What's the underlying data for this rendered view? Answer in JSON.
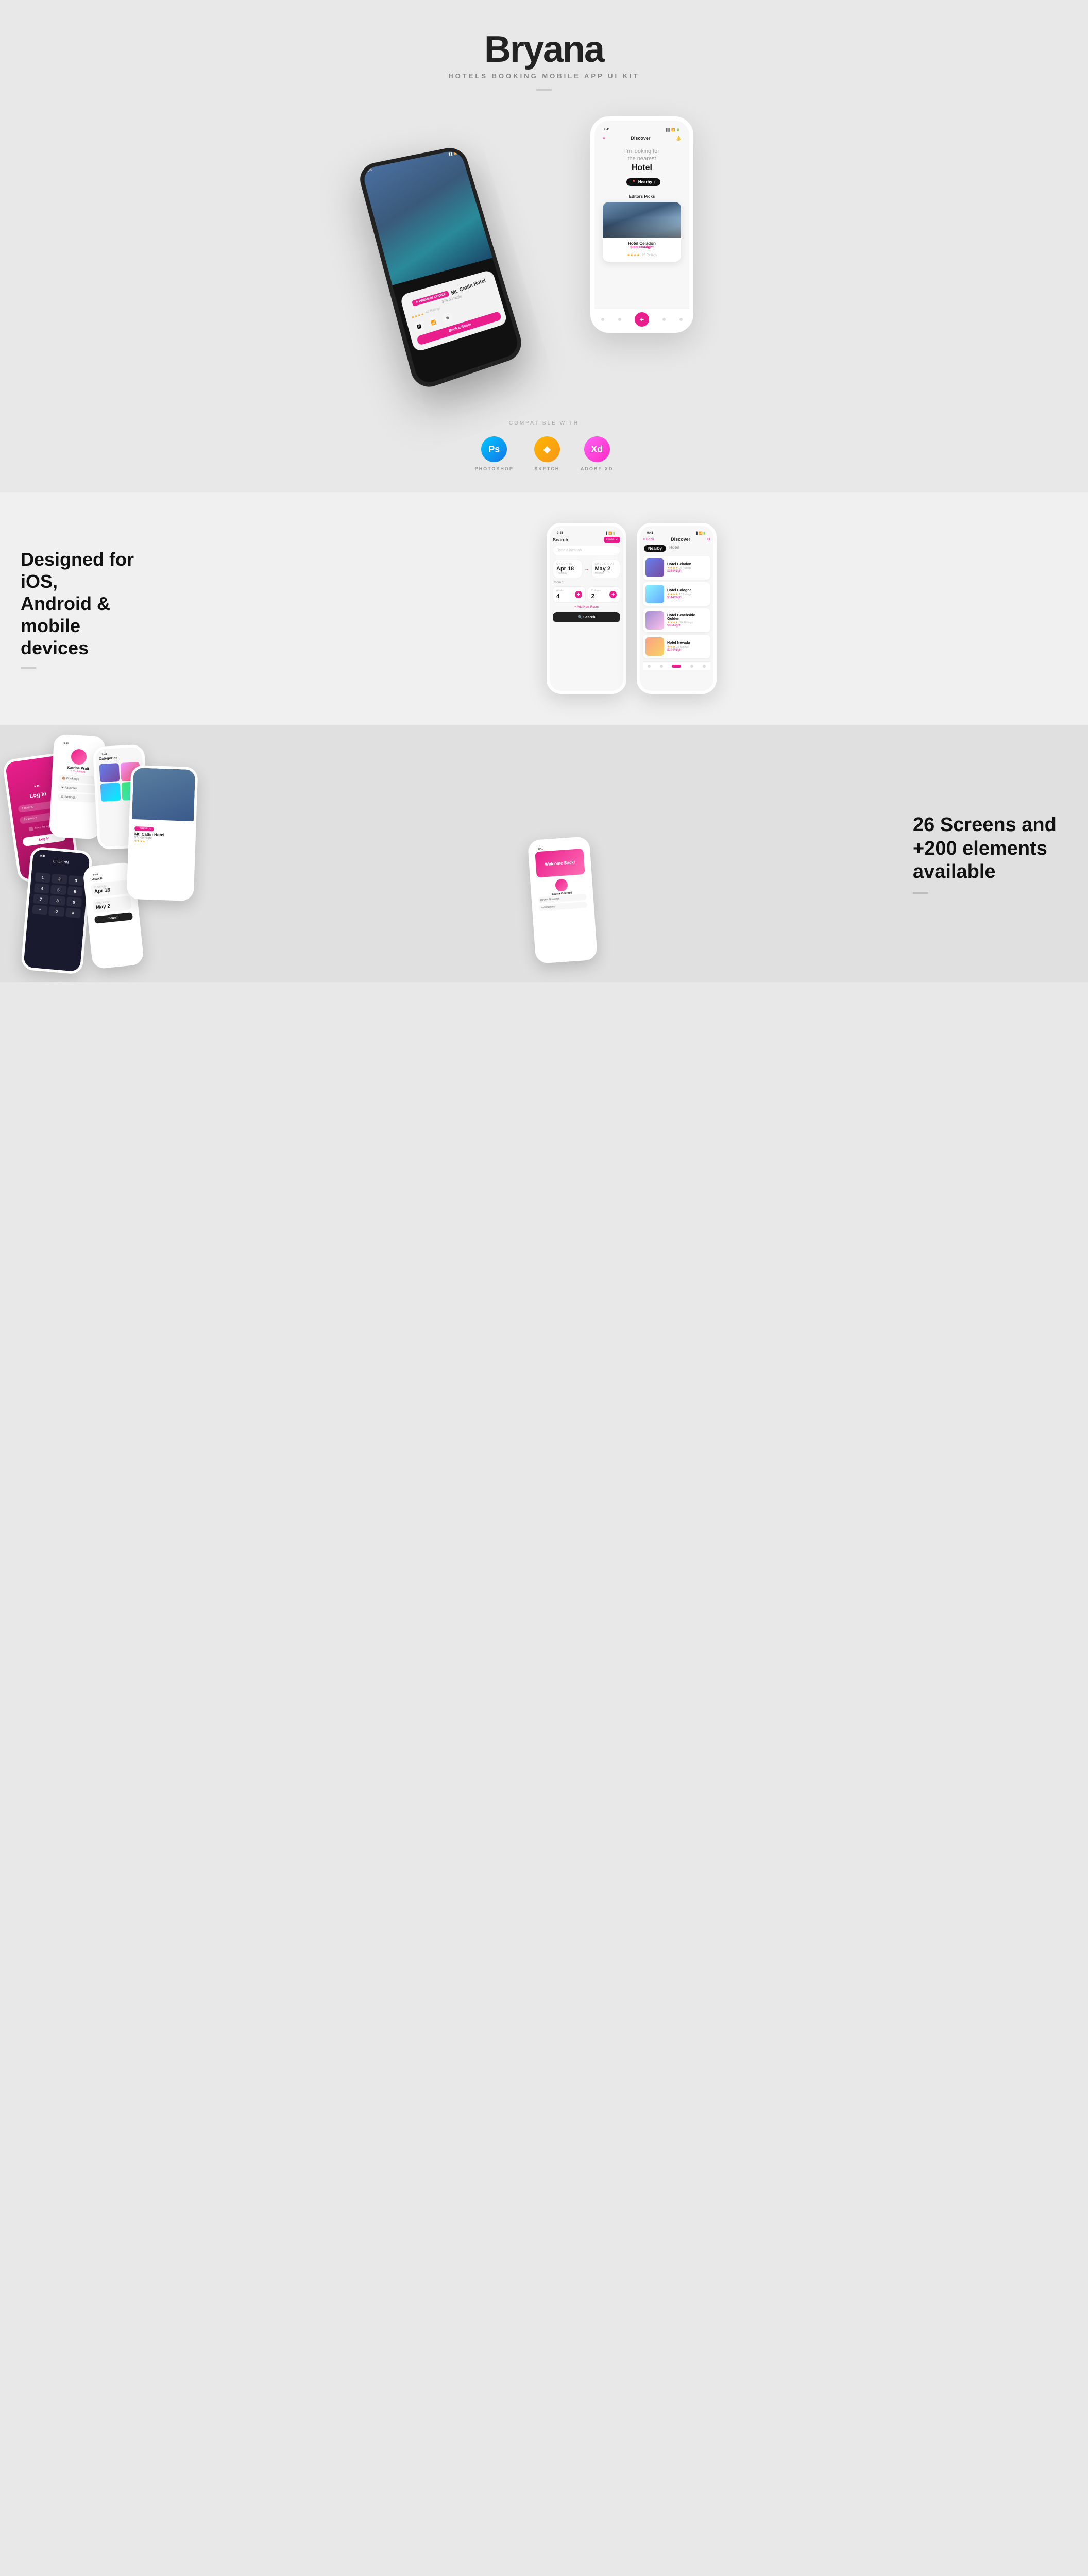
{
  "hero": {
    "title": "Bryana",
    "subtitle": "HOTELS BOOKING MOBILE APP UI KIT",
    "divider_label": "—"
  },
  "compat": {
    "label": "COMPATIBLE WITH",
    "tools": [
      {
        "id": "photoshop",
        "short": "Ps",
        "label": "PHOTOSHOP",
        "class": "ps-icon"
      },
      {
        "id": "sketch",
        "short": "S",
        "label": "SKETCH",
        "class": "sketch-icon"
      },
      {
        "id": "adobexd",
        "short": "Xd",
        "label": "ADOBE XD",
        "class": "xd-icon"
      }
    ]
  },
  "ios_section": {
    "title": "Designed for iOS,\nAndroid & mobile\ndevices",
    "line1": "Designed for iOS,",
    "line2": "Android & mobile",
    "line3": "devices"
  },
  "search_phone": {
    "status_time": "9:41",
    "header_title": "Search",
    "close_label": "Close ✕",
    "search_placeholder": "Type a location...",
    "checkin_label": "CHECK IN",
    "checkin_date": "Apr 18",
    "checkin_day": "Thursday",
    "checkout_label": "CHECK OUT",
    "checkout_date": "May 2",
    "checkout_day": "Monday",
    "room_label": "Room 1",
    "adults_label": "Adults",
    "adults_count": "4",
    "children_label": "Children",
    "children_count": "2",
    "add_room": "+ Add New Room",
    "search_btn": "🔍 Search"
  },
  "discover_phone": {
    "status_time": "9:41",
    "back_label": "< Back",
    "title": "Discover",
    "nearby_label": "Nearby",
    "hotel_label": "Hotel",
    "hotels": [
      {
        "name": "Hotel Celadon",
        "price": "$164/Night",
        "stars": "★★★★",
        "ratings": "24 Ratings",
        "class": "hotel-list-thumb-1"
      },
      {
        "name": "Hotel Cologne",
        "price": "$144/Night",
        "stars": "★★★★",
        "ratings": "15 Ratings",
        "class": "hotel-list-thumb-2"
      },
      {
        "name": "Hotel Beachside Golden",
        "price": "$96/Night",
        "stars": "★★★★",
        "ratings": "324 Ratings",
        "class": "hotel-list-thumb-3"
      },
      {
        "name": "Hotel Nevada",
        "price": "$144/Night",
        "stars": "★★★",
        "ratings": "36 Ratings",
        "class": "hotel-list-thumb-4"
      }
    ]
  },
  "screens_section": {
    "title": "26 Screens and\n+200 elements\navailable",
    "line1": "26 Screens and",
    "line2": "+200 elements",
    "line3": "available"
  }
}
